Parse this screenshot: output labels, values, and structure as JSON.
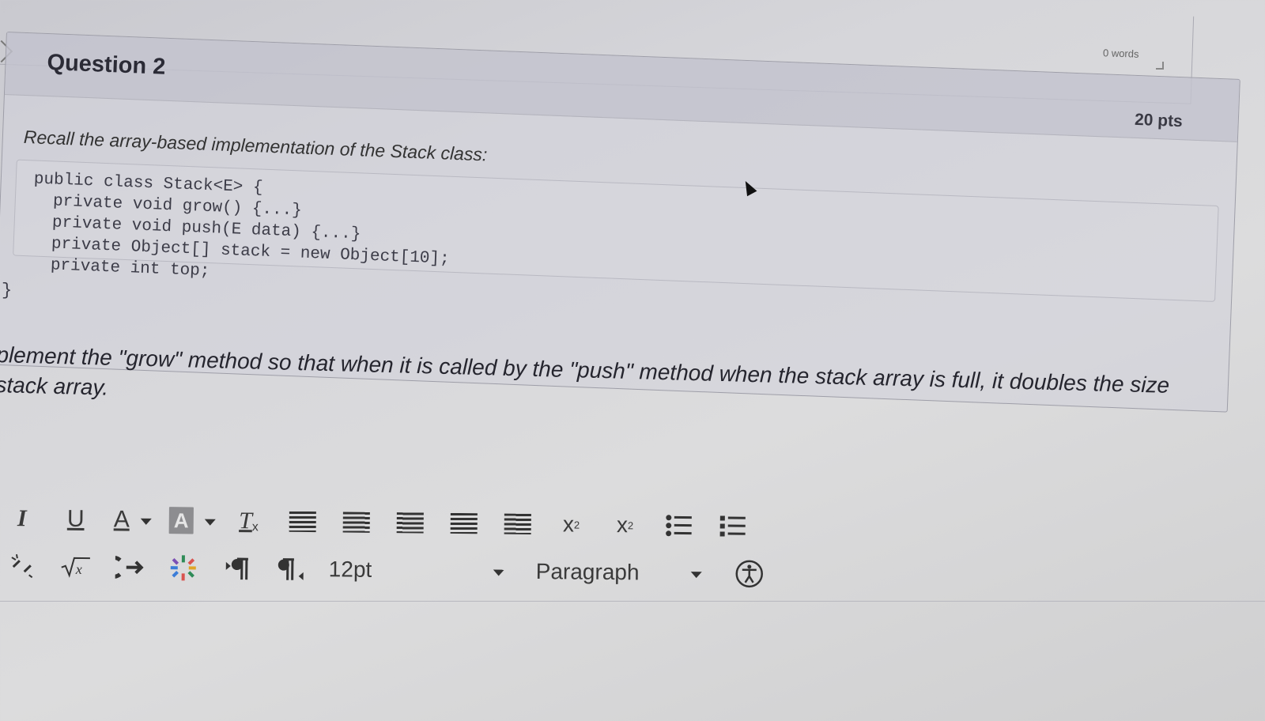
{
  "prev_question": {
    "word_count": "0 words"
  },
  "question": {
    "title": "Question 2",
    "points": "20 pts",
    "prompt": "Recall the array-based implementation of the Stack class:",
    "code_lines": [
      "public class Stack<E> {",
      "  private void grow() {...}",
      "  private void push(E data) {...}",
      "  private Object[] stack = new Object[10];",
      "  private int top;"
    ],
    "closing_brace": "}",
    "instruction_line1": "plement the \"grow\" method so that when it is called by the \"push\" method when the stack array is full, it doubles the size",
    "instruction_line2": "stack array."
  },
  "toolbar": {
    "row1": {
      "italic": "I",
      "underline": "U",
      "font_color": "A",
      "highlight": "A",
      "clear_format": "T",
      "clear_format_sub": "x",
      "superscript": "x",
      "superscript_mark": "2",
      "subscript": "x",
      "subscript_mark": "2"
    },
    "row2": {
      "font_size": "12pt",
      "block_format": "Paragraph"
    }
  }
}
